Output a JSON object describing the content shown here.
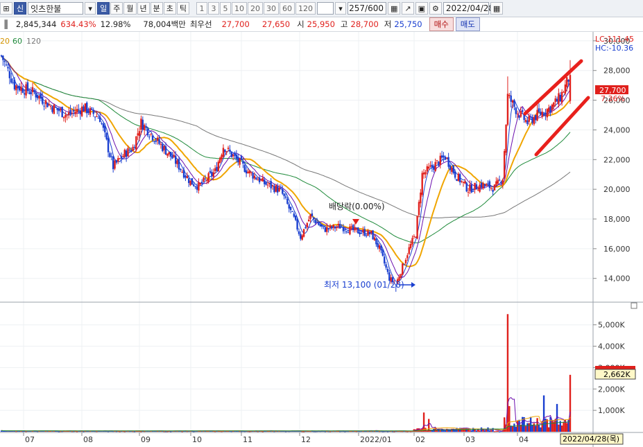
{
  "toolbar": {
    "stock_code_tag": "신",
    "stock_name": "잇츠한불",
    "periods": [
      "일",
      "주",
      "월",
      "년",
      "분",
      "초",
      "틱"
    ],
    "active_period": "일",
    "intervals": [
      "1",
      "3",
      "5",
      "10",
      "20",
      "30",
      "60",
      "120"
    ],
    "bar_count": "257/600",
    "date": "2022/04/28"
  },
  "info": {
    "volume": "2,845,344",
    "change_pct": "634.43%",
    "turnover": "12.98%",
    "amount": "78,004백만",
    "price_label": "최우선",
    "best_ask": "27,700",
    "best_bid": "27,650",
    "open_label": "시",
    "open": "25,950",
    "high_label": "고",
    "high": "28,700",
    "low_label": "저",
    "low": "25,750",
    "buy_label": "매수",
    "sell_label": "매도"
  },
  "ma_legend": [
    "20",
    "60",
    "120"
  ],
  "colors": {
    "up": "#e0201c",
    "down": "#1a3fd0",
    "ma5": "#1a3fd0",
    "ma10": "#6a0dad",
    "ma20": "#f0a500",
    "ma60": "#1e8a3a",
    "ma120": "#777777",
    "accent": "#3b5ba5"
  },
  "price_axis": {
    "ticks": [
      "30,000",
      "28,000",
      "26,000",
      "24,000",
      "22,000",
      "20,000",
      "18,000",
      "16,000",
      "14,000"
    ],
    "lc": "LC:111.45",
    "hc": "HC:-10.36",
    "current": "27,700",
    "current_pct": "7.36%"
  },
  "volume_axis": {
    "ticks": [
      "5,000K",
      "4,000K",
      "3,000K",
      "2,000K",
      "1,000K"
    ],
    "current": "2,662K"
  },
  "x_labels": [
    "07",
    "08",
    "09",
    "10",
    "11",
    "12",
    "2022/01",
    "02",
    "03",
    "04"
  ],
  "x_cursor": "2022/04/28(목)",
  "annotations": {
    "dividend": "배당락(0.00%)",
    "low": "최저 13,100 (01/28)"
  },
  "chart_data": {
    "type": "candlestick",
    "price_range": [
      12400,
      30600
    ],
    "volume_range_k": [
      0,
      5800
    ],
    "month_labels": [
      "07",
      "08",
      "09",
      "10",
      "11",
      "12",
      "2022/01",
      "02",
      "03",
      "04"
    ],
    "low_point": {
      "price": 13100,
      "date": "01/28"
    },
    "last": {
      "open": 25950,
      "high": 28700,
      "low": 25750,
      "close": 27700,
      "volume_k": 2662
    },
    "moving_averages": [
      "5",
      "10",
      "20",
      "60",
      "120"
    ]
  }
}
